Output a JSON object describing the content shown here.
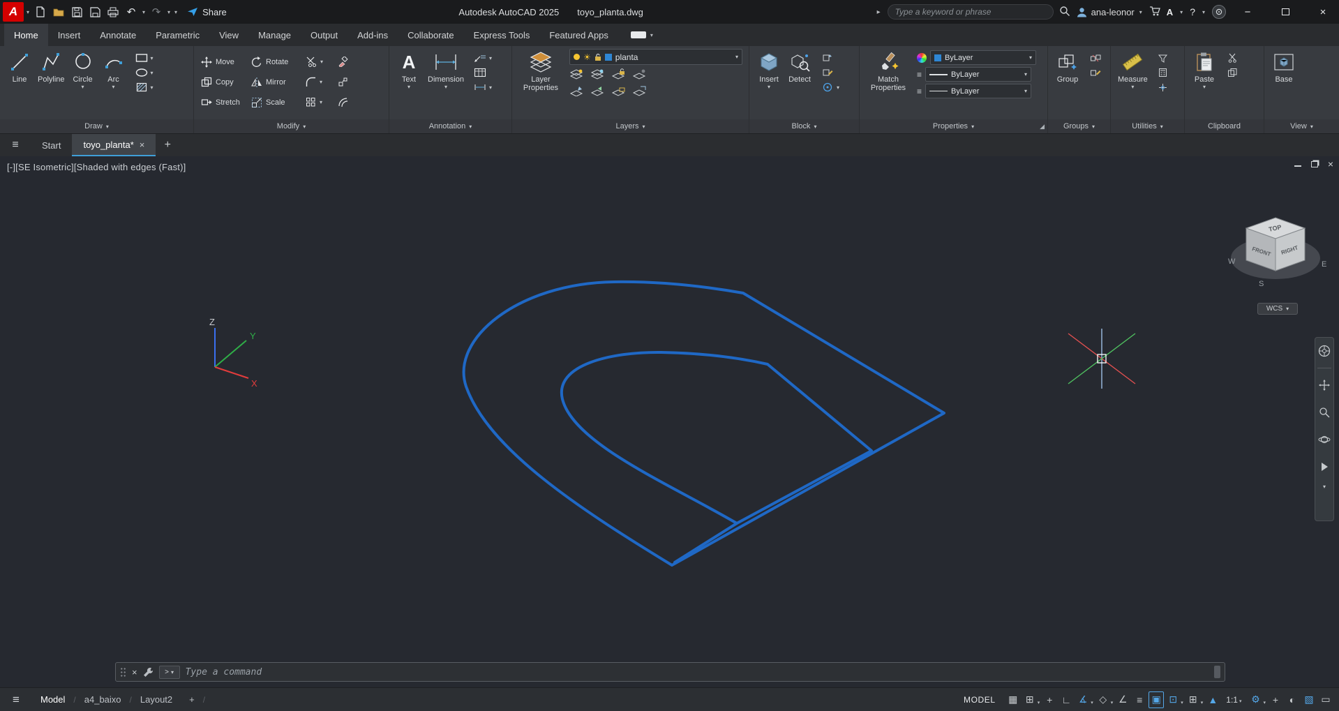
{
  "colors": {
    "accent_blue": "#54a7e8",
    "drawing_line_blue": "#1f68c5",
    "logo_red": "#d40000",
    "share_blue": "#35a0e8",
    "bulb_yellow": "#f5c431",
    "axis_x_red": "#e23c3c",
    "axis_y_green": "#2fae47",
    "axis_z_blue": "#3a6ff0"
  },
  "icons": {
    "chevron_down": "▾",
    "hamburger": "≡",
    "close": "×",
    "minimize": "−",
    "plus": "+",
    "undo": "↶",
    "redo": "↷",
    "caret_right": "▸",
    "slash": "/",
    "help": "?",
    "autodesk": "A",
    "logo": "A",
    "prompt": ">"
  },
  "titlebar": {
    "app_title": "Autodesk AutoCAD 2025",
    "doc_title": "toyo_planta.dwg",
    "share": "Share",
    "search_placeholder": "Type a keyword or phrase",
    "user": "ana-leonor"
  },
  "ribbon": {
    "tabs": [
      "Home",
      "Insert",
      "Annotate",
      "Parametric",
      "View",
      "Manage",
      "Output",
      "Add-ins",
      "Collaborate",
      "Express Tools",
      "Featured Apps"
    ],
    "panels": {
      "draw": {
        "label": "Draw",
        "line": "Line",
        "polyline": "Polyline",
        "circle": "Circle",
        "arc": "Arc"
      },
      "modify": {
        "label": "Modify",
        "move": "Move",
        "rotate": "Rotate",
        "copy": "Copy",
        "mirror": "Mirror",
        "stretch": "Stretch",
        "scale": "Scale"
      },
      "annotation": {
        "label": "Annotation",
        "text": "Text",
        "dimension": "Dimension"
      },
      "layers": {
        "label": "Layers",
        "layer_properties": "Layer Properties",
        "current_layer": "planta"
      },
      "block": {
        "label": "Block",
        "insert": "Insert",
        "detect": "Detect"
      },
      "properties": {
        "label": "Properties",
        "match_properties": "Match Properties",
        "color_value": "ByLayer",
        "lineweight_value": "ByLayer",
        "linetype_value": "ByLayer"
      },
      "groups": {
        "label": "Groups",
        "group": "Group"
      },
      "utilities": {
        "label": "Utilities",
        "measure": "Measure"
      },
      "clipboard": {
        "label": "Clipboard",
        "paste": "Paste"
      },
      "view": {
        "label": "View",
        "base": "Base"
      }
    }
  },
  "file_tabs": {
    "start": "Start",
    "active_tab": "toyo_planta*"
  },
  "viewport": {
    "label": "[-][SE Isometric][Shaded with edges (Fast)]",
    "wcs": "WCS",
    "cube": {
      "top": "TOP",
      "front": "FRONT",
      "right": "RIGHT"
    },
    "compass": {
      "w": "W",
      "s": "S",
      "e": "E"
    },
    "axes": {
      "x": "X",
      "y": "Y",
      "z": "Z"
    }
  },
  "command_line": {
    "prompt": "Type a command"
  },
  "status": {
    "layout_tabs": [
      "Model",
      "a4_baixo",
      "Layout2"
    ],
    "mode": "MODEL",
    "scale": "1:1"
  },
  "status_icons": {
    "grid": "▦",
    "snap": "⊞",
    "dyn": "+",
    "ortho": "∟",
    "polar": "∡",
    "iso": "◇",
    "otrack": "∠",
    "lwt": "≡",
    "cycle": "▣",
    "osnap": "⊡",
    "osnap3d": "⊞",
    "anno": "▲",
    "gear": "⚙",
    "monitor": "+",
    "isolate": "◐",
    "gpu": "▧",
    "clean": "▭"
  }
}
